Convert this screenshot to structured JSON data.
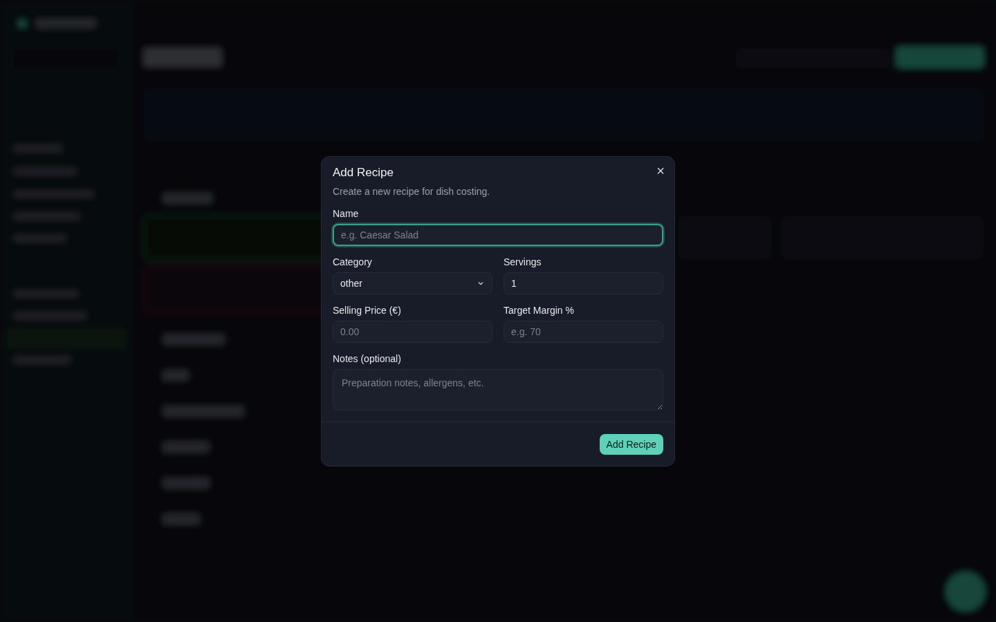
{
  "dialog": {
    "title": "Add Recipe",
    "description": "Create a new recipe for dish costing.",
    "close": "×",
    "fields": [
      {
        "kind": "input",
        "label": "Name",
        "placeholder": "e.g. Caesar Salad",
        "focused": true,
        "wide": true
      },
      {
        "kind": "select",
        "label": "Category",
        "value": "other",
        "focused": false,
        "wide": false
      },
      {
        "kind": "input",
        "label": "Servings",
        "value": "1",
        "focused": false,
        "wide": false
      },
      {
        "kind": "input",
        "label": "Selling Price (€)",
        "placeholder": "0.00",
        "focused": false,
        "wide": false
      },
      {
        "kind": "input",
        "label": "Target Margin %",
        "placeholder": "e.g. 70",
        "focused": false,
        "wide": false
      },
      {
        "kind": "textarea",
        "label": "Notes (optional)",
        "placeholder": "Preparation notes, allergens, etc.",
        "focused": false,
        "wide": true
      }
    ],
    "submit": "Add Recipe"
  }
}
